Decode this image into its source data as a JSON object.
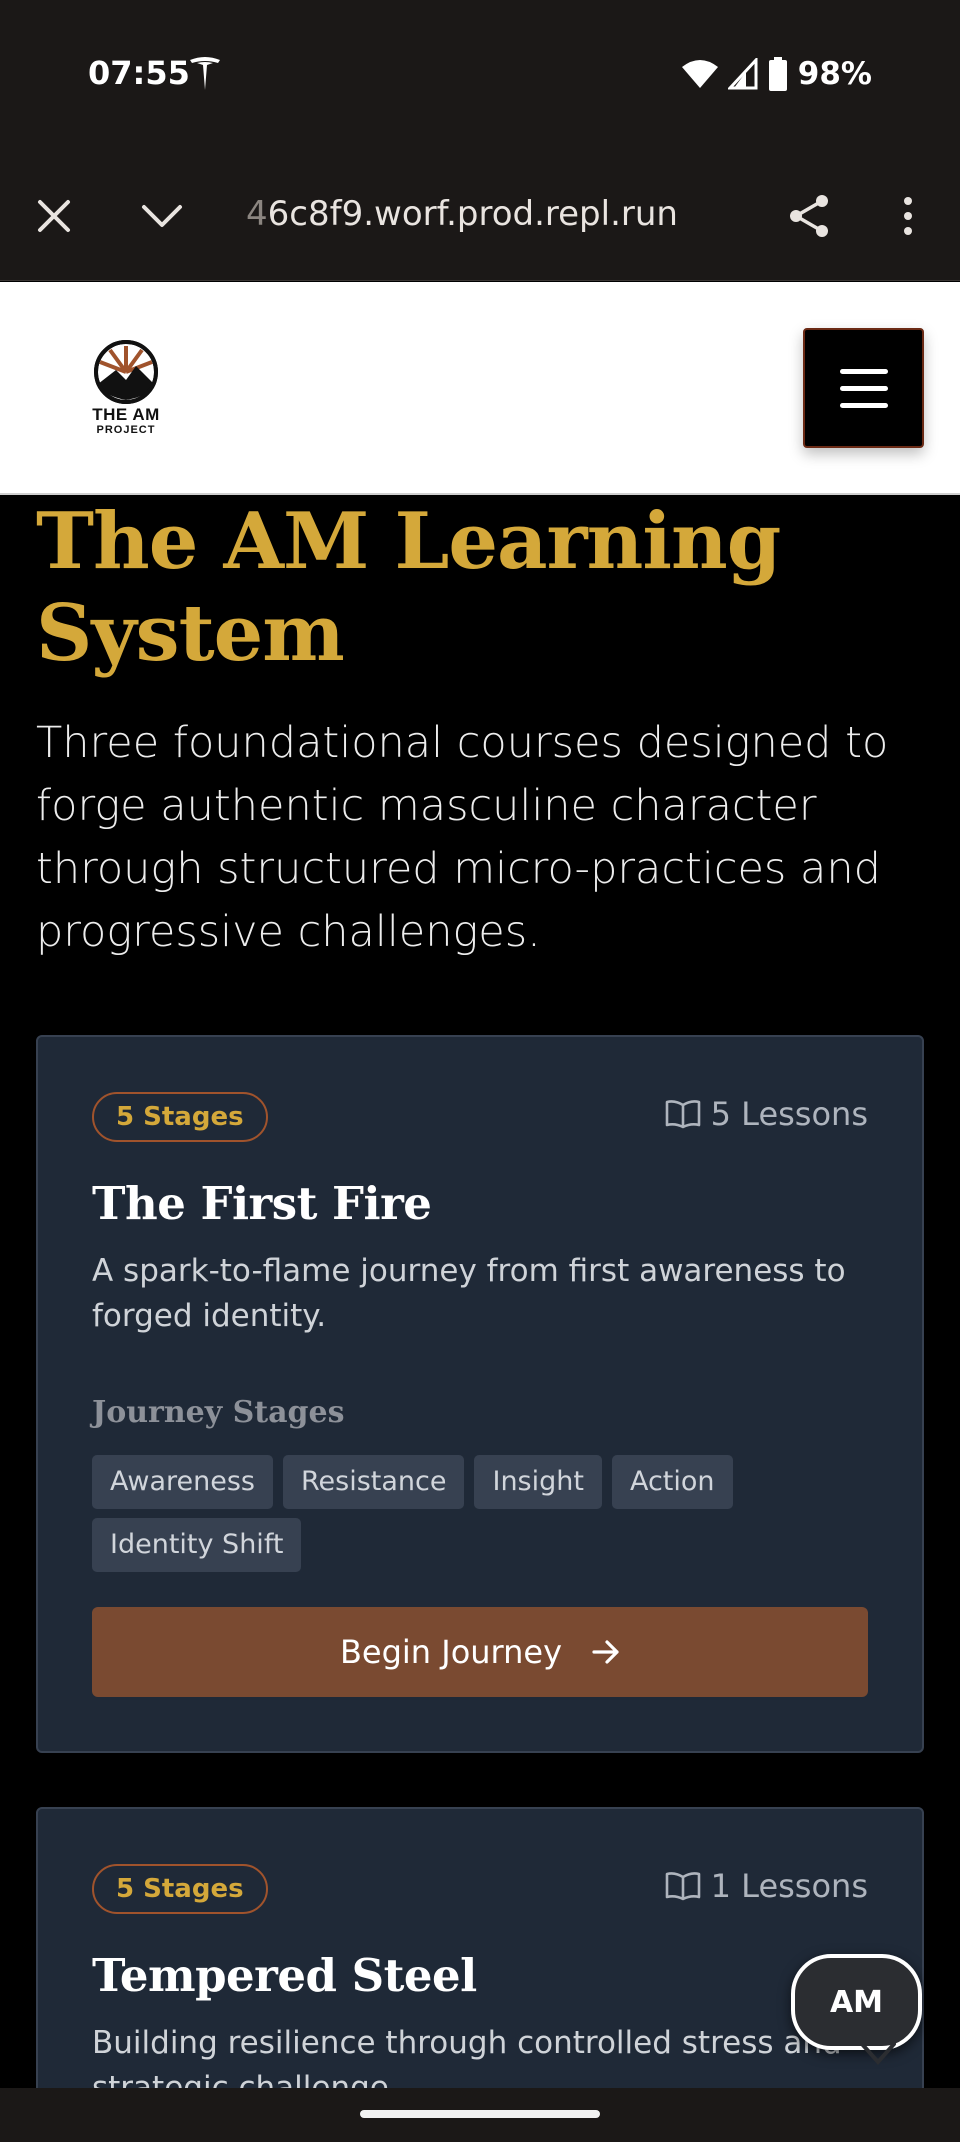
{
  "status_bar": {
    "time": "07:55",
    "battery": "98%",
    "icons": [
      "tesla-icon",
      "wifi-icon",
      "signal-icon",
      "battery-icon"
    ]
  },
  "browser": {
    "url_faded": "4",
    "url": "6c8f9.worf.prod.repl.run",
    "icons": [
      "close-icon",
      "chevron-down-icon",
      "share-icon",
      "more-vert-icon"
    ]
  },
  "header": {
    "logo_line1": "THE AM",
    "logo_line2": "PROJECT",
    "menu_icon": "hamburger-icon"
  },
  "hero": {
    "title": "The AM Learning System",
    "description": "Three foundational courses designed to forge authentic masculine character through structured micro-practices and progressive challenges."
  },
  "courses": [
    {
      "badge": "5 Stages",
      "lessons": "5 Lessons",
      "title": "The First Fire",
      "description": "A spark-to-flame journey from first awareness to forged identity.",
      "stages_heading": "Journey Stages",
      "stages": [
        "Awareness",
        "Resistance",
        "Insight",
        "Action",
        "Identity Shift"
      ],
      "button": "Begin Journey"
    },
    {
      "badge": "5 Stages",
      "lessons": "1 Lessons",
      "title": "Tempered Steel",
      "description": "Building resilience through controlled stress and strategic challenge."
    }
  ],
  "floating": {
    "label": "AM"
  },
  "colors": {
    "gold": "#d4a83a",
    "card_bg": "#1f2937",
    "button_brown": "#7a4a31",
    "badge_border": "#a0532c"
  }
}
